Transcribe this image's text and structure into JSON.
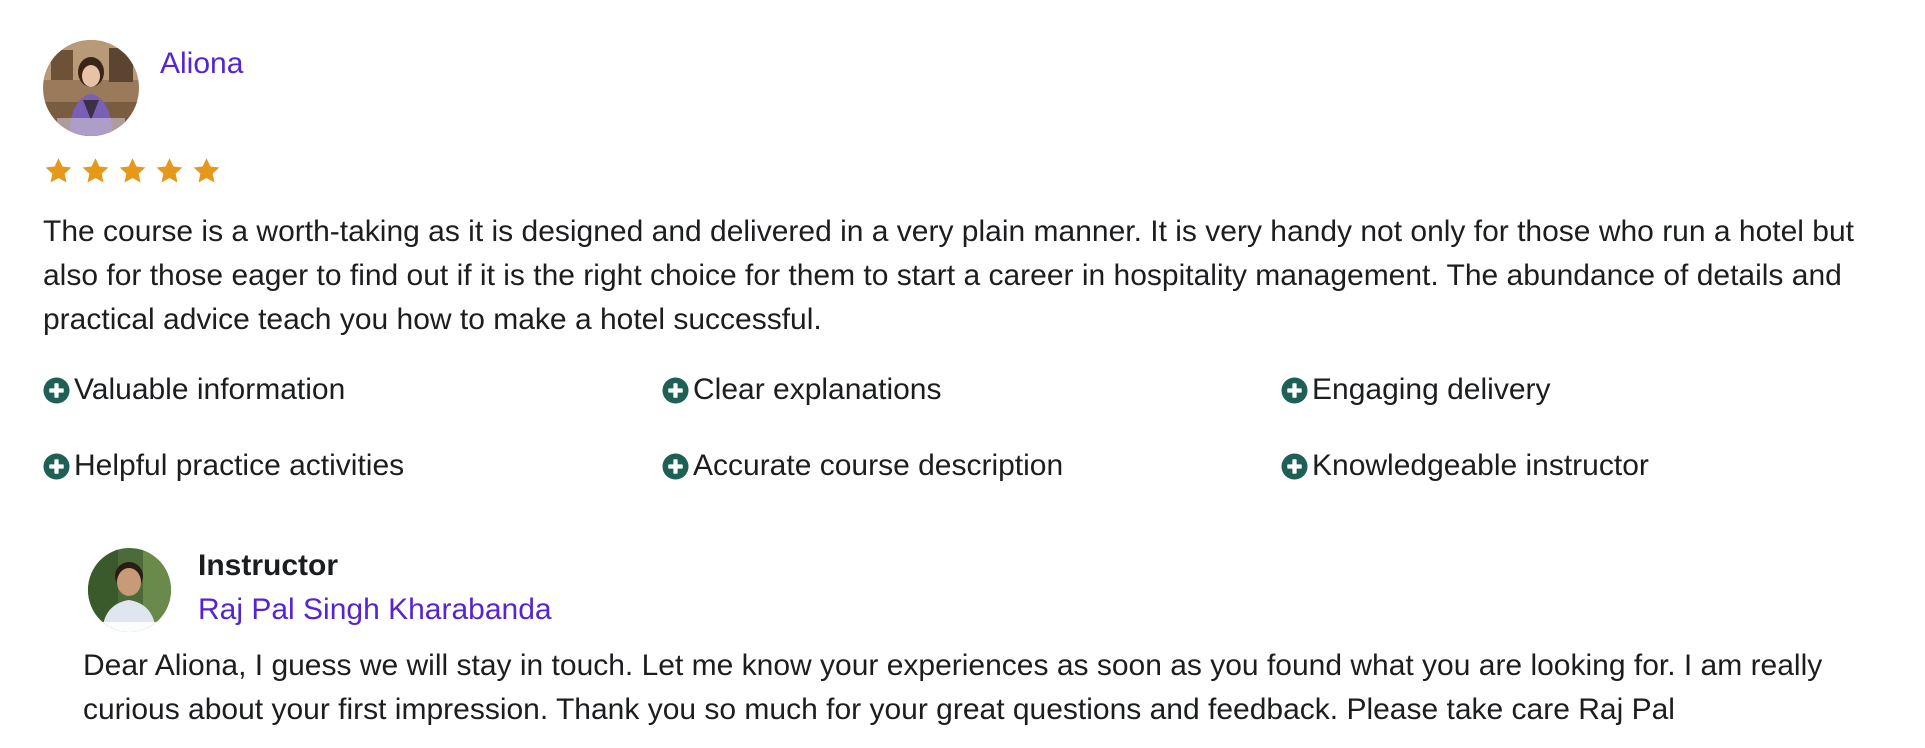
{
  "review": {
    "reviewer_name": "Aliona",
    "rating": 5,
    "rating_max": 5,
    "star_color": "#e59819",
    "text": "The course is a worth-taking as it is designed and delivered in a very plain manner. It is very handy not only for those who run a hotel but also for those eager to find out if it is the right choice for them to start a career in hospitality management. The abundance of details and practical advice teach you how to make a hotel successful.",
    "tags": [
      "Valuable information",
      "Clear explanations",
      "Engaging delivery",
      "Helpful practice activities",
      "Accurate course description",
      "Knowledgeable instructor"
    ],
    "tag_icon": "plus-circle-icon",
    "tag_icon_color": "#1e6055"
  },
  "response": {
    "label": "Instructor",
    "instructor_name": "Raj Pal Singh Kharabanda",
    "text": "Dear Aliona, I guess we will stay in touch. Let me know your experiences as soon as you found what you are looking for. I am really curious about your first impression. Thank you so much for your great questions and feedback. Please take care Raj Pal"
  },
  "colors": {
    "link": "#5624d0",
    "text": "#1c1d1f"
  }
}
